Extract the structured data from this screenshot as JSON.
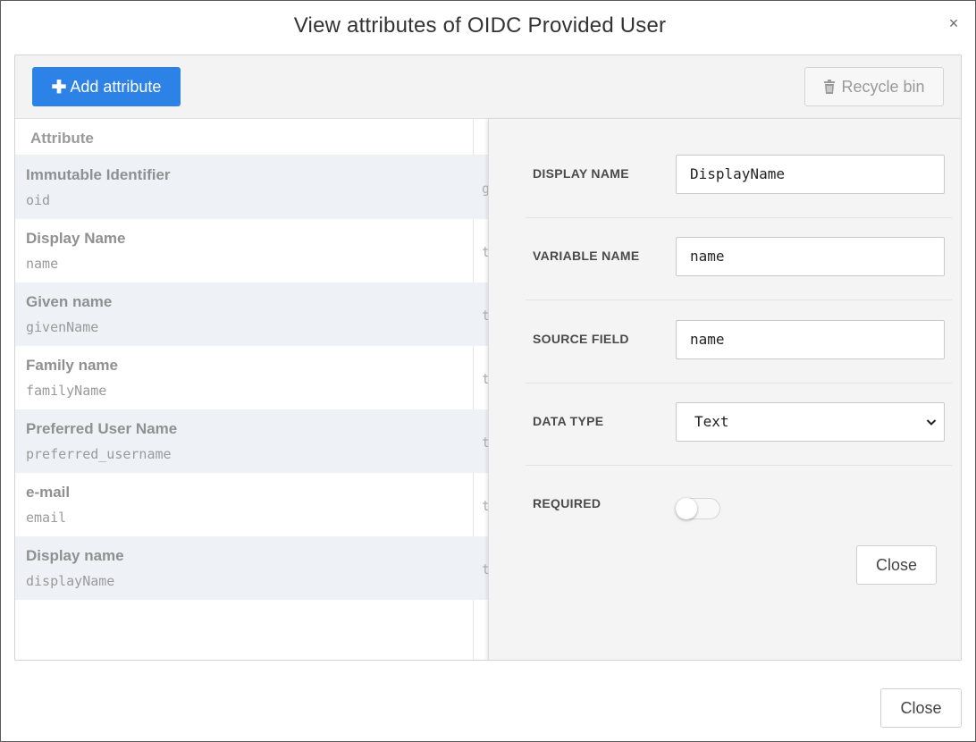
{
  "dialog": {
    "title": "View attributes of OIDC Provided User",
    "close_glyph": "×",
    "close_label": "Close"
  },
  "toolbar": {
    "add_label": "Add attribute",
    "add_icon": "plus-icon",
    "recycle_label": "Recycle bin",
    "recycle_icon": "trash-icon"
  },
  "table": {
    "header": "Attribute",
    "rows": [
      {
        "name": "Immutable Identifier",
        "variable": "oid",
        "extra": "g"
      },
      {
        "name": "Display Name",
        "variable": "name",
        "extra": "t"
      },
      {
        "name": "Given name",
        "variable": "givenName",
        "extra": "t"
      },
      {
        "name": "Family name",
        "variable": "familyName",
        "extra": "t"
      },
      {
        "name": "Preferred User Name",
        "variable": "preferred_username",
        "extra": "t"
      },
      {
        "name": "e-mail",
        "variable": "email",
        "extra": "t"
      },
      {
        "name": "Display name",
        "variable": "displayName",
        "extra": "t"
      }
    ]
  },
  "editor": {
    "display_name": {
      "label": "DISPLAY NAME",
      "value": "DisplayName"
    },
    "variable_name": {
      "label": "VARIABLE NAME",
      "value": "name"
    },
    "source_field": {
      "label": "SOURCE FIELD",
      "value": "name"
    },
    "data_type": {
      "label": "DATA TYPE",
      "value": "Text"
    },
    "required": {
      "label": "REQUIRED",
      "on": false
    },
    "close_label": "Close"
  },
  "colors": {
    "primary": "#2d82e8",
    "row_alt": "#eef2f7",
    "side_bg": "#f4f4f4"
  }
}
